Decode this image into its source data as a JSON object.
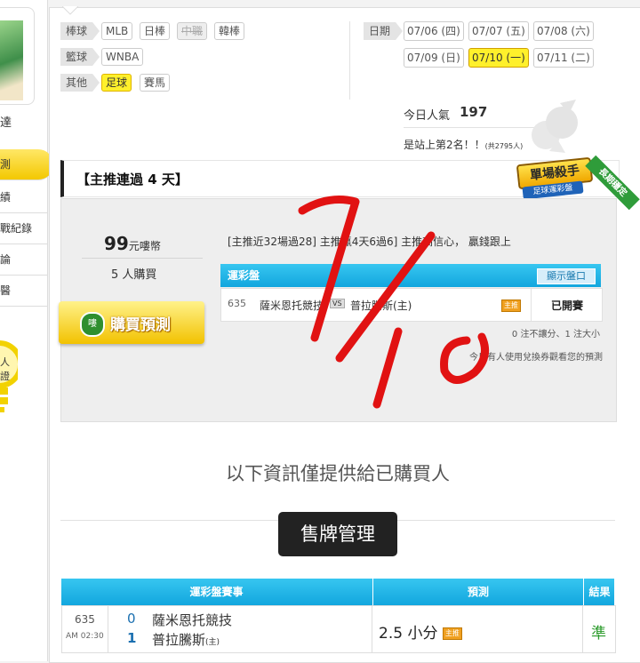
{
  "sidebar": {
    "name_fragment": "達",
    "menu": [
      "測",
      "績",
      "戰紀錄",
      "論",
      "醫"
    ],
    "bulb_lines": [
      "人",
      "證"
    ]
  },
  "sports": {
    "baseball_label": "棒球",
    "baseball": [
      "MLB",
      "日棒",
      "中職",
      "韓棒"
    ],
    "basketball_label": "籃球",
    "basketball": [
      "WNBA"
    ],
    "other_label": "其他",
    "other": [
      "足球",
      "賽馬"
    ]
  },
  "dates": {
    "label": "日期",
    "items": [
      "07/06 (四)",
      "07/07 (五)",
      "07/08 (六)",
      "07/09 (日)",
      "07/10 (一)",
      "07/11 (二)"
    ]
  },
  "popularity": {
    "label": "今日人氣",
    "value": "197",
    "rank_text": "是站上第2名！！",
    "rank_sub": "(共2795人)"
  },
  "promo": {
    "title": "【主推連過 4 天】",
    "badge_main": "單場殺手",
    "badge_sub": "足球運彩盤",
    "badge_ribbon": "長期穩定"
  },
  "offer": {
    "price": "99",
    "price_unit": "元嘍幣",
    "buyers": "5 人購買",
    "buy_button": "購買預測",
    "buy_icon_text": "嘍",
    "summary": "[主推近32場過28] 主推贏4天6過6] 主推高信心， 贏錢跟上"
  },
  "mini_table": {
    "title": "運彩盤",
    "show_button": "顯示盤口",
    "game_no": "635",
    "home": "薩米恩托競技",
    "vs": "VS",
    "away": "普拉騰斯(主)",
    "tag": "主推",
    "status": "已開賽",
    "note1": "0 注不讓分、1 注大小",
    "note2": "今日有人使用兌換券觀看您的預測"
  },
  "info_text": "以下資訊僅提供給已購買人",
  "sale_button": "售牌管理",
  "result_table": {
    "headers": [
      "運彩盤賽事",
      "預測",
      "結果"
    ],
    "game_no": "635",
    "time": "AM 02:30",
    "team1_score": "0",
    "team1": "薩米恩托競技",
    "team2_score": "1",
    "team2": "普拉騰斯",
    "team2_mark": "(主)",
    "prediction": "2.5 小分",
    "tag": "主推",
    "result": "準"
  },
  "handwriting": "7/10",
  "colors": {
    "accent_yellow": "#fff02b",
    "table_blue": "#19aae0",
    "handwriting_red": "#e11212",
    "win_green": "#2a9a2a"
  }
}
